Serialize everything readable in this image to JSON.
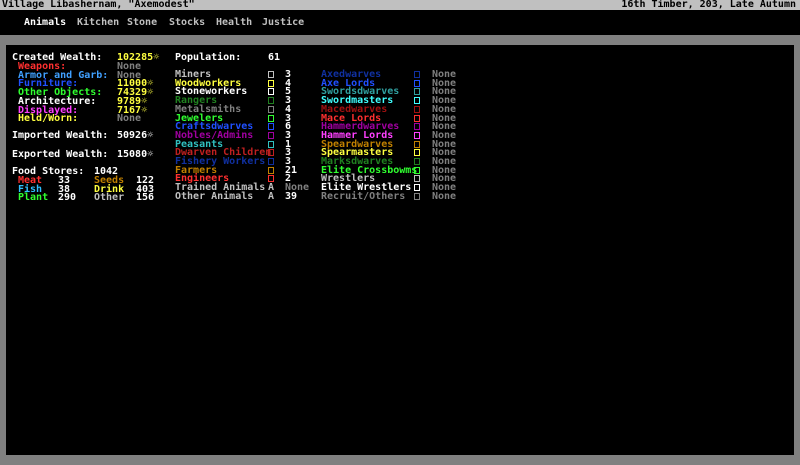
{
  "header": {
    "title": "Village Libashernam, \"Axemodest\"",
    "date": "16th Timber, 203, Late Autumn"
  },
  "tabs": [
    {
      "label": "Animals",
      "active": true
    },
    {
      "label": "Kitchen",
      "active": false
    },
    {
      "label": "Stone",
      "active": false
    },
    {
      "label": "Stocks",
      "active": false
    },
    {
      "label": "Health",
      "active": false
    },
    {
      "label": "Justice",
      "active": false
    }
  ],
  "wealth": {
    "created_label": "Created Wealth:",
    "created_value": "102285☼",
    "items": [
      {
        "label": "Weapons:",
        "value": "None",
        "label_color": "#ff3030",
        "value_color": "#808080"
      },
      {
        "label": "Armor and Garb:",
        "value": "None",
        "label_color": "#40a0ff",
        "value_color": "#808080"
      },
      {
        "label": "Furniture:",
        "value": "11000☼",
        "label_color": "#2050ff",
        "value_color": "#ffff40"
      },
      {
        "label": "Other Objects:",
        "value": "74329☼",
        "label_color": "#30ff30",
        "value_color": "#ffff40"
      },
      {
        "label": "Architecture:",
        "value": "9789☼",
        "label_color": "#ffffff",
        "value_color": "#ffff40"
      },
      {
        "label": "Displayed:",
        "value": "7167☼",
        "label_color": "#ff40ff",
        "value_color": "#ffff40"
      },
      {
        "label": "Held/Worn:",
        "value": "None",
        "label_color": "#ffff40",
        "value_color": "#808080"
      }
    ],
    "imported_label": "Imported Wealth:",
    "imported_value": "50926☼",
    "exported_label": "Exported Wealth:",
    "exported_value": "15080☼"
  },
  "food": {
    "label": "Food Stores:",
    "value": "1042",
    "items": [
      {
        "label": "Meat",
        "value": "33",
        "color": "#ff3030"
      },
      {
        "label": "Seeds",
        "value": "122",
        "color": "#c08000"
      },
      {
        "label": "Fish",
        "value": "38",
        "color": "#30c0ff"
      },
      {
        "label": "Drink",
        "value": "403",
        "color": "#ffff40"
      },
      {
        "label": "Plant",
        "value": "290",
        "color": "#30ff30"
      },
      {
        "label": "Other",
        "value": "156",
        "color": "#c0c0c0"
      }
    ]
  },
  "population": {
    "label": "Population:",
    "value": "61",
    "civilians": [
      {
        "label": "Miners",
        "value": "3",
        "color": "#c0c0c0"
      },
      {
        "label": "Woodworkers",
        "value": "4",
        "color": "#ffff40"
      },
      {
        "label": "Stoneworkers",
        "value": "5",
        "color": "#ffffff"
      },
      {
        "label": "Rangers",
        "value": "3",
        "color": "#208020"
      },
      {
        "label": "Metalsmiths",
        "value": "4",
        "color": "#808080"
      },
      {
        "label": "Jewelers",
        "value": "3",
        "color": "#30ff30"
      },
      {
        "label": "Craftsdwarves",
        "value": "6",
        "color": "#2050ff"
      },
      {
        "label": "Nobles/Admins",
        "value": "3",
        "color": "#a000a0"
      },
      {
        "label": "Peasants",
        "value": "1",
        "color": "#30c0c0"
      },
      {
        "label": "Dwarven Children",
        "value": "3",
        "color": "#c02020"
      },
      {
        "label": "Fishery Workers",
        "value": "3",
        "color": "#1030a0"
      },
      {
        "label": "Farmers",
        "value": "21",
        "color": "#c08000"
      },
      {
        "label": "Engineers",
        "value": "2",
        "color": "#ff3030"
      },
      {
        "label": "Trained Animals",
        "value": "None",
        "color": "#c0c0c0",
        "code": "A"
      },
      {
        "label": "Other Animals",
        "value": "39",
        "color": "#c0c0c0",
        "code": "A"
      }
    ],
    "military": [
      {
        "label": "Axedwarves",
        "value": "None",
        "color": "#1030a0"
      },
      {
        "label": "Axe Lords",
        "value": "None",
        "color": "#2050ff"
      },
      {
        "label": "Swordsdwarves",
        "value": "None",
        "color": "#30a0a0"
      },
      {
        "label": "Swordmasters",
        "value": "None",
        "color": "#40ffff"
      },
      {
        "label": "Macedwarves",
        "value": "None",
        "color": "#a01010"
      },
      {
        "label": "Mace Lords",
        "value": "None",
        "color": "#ff3030"
      },
      {
        "label": "Hammerdwarves",
        "value": "None",
        "color": "#a000a0"
      },
      {
        "label": "Hammer Lords",
        "value": "None",
        "color": "#ff40ff"
      },
      {
        "label": "Speardwarves",
        "value": "None",
        "color": "#c08000"
      },
      {
        "label": "Spearmasters",
        "value": "None",
        "color": "#ffff40"
      },
      {
        "label": "Marksdwarves",
        "value": "None",
        "color": "#208020"
      },
      {
        "label": "Elite Crossbowms",
        "value": "None",
        "color": "#30ff30"
      },
      {
        "label": "Wrestlers",
        "value": "None",
        "color": "#c0c0c0"
      },
      {
        "label": "Elite Wrestlers",
        "value": "None",
        "color": "#ffffff"
      },
      {
        "label": "Recruit/Others",
        "value": "None",
        "color": "#808080"
      }
    ]
  }
}
